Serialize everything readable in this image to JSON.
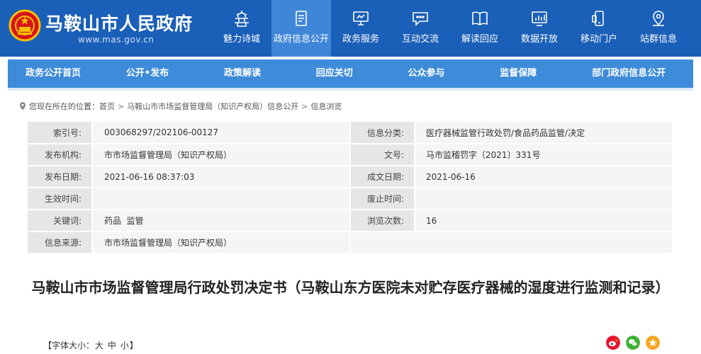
{
  "header": {
    "site_title": "马鞍山市人民政府",
    "site_url": "www.mas.gov.cn",
    "brand_color": "#1a5fb8",
    "active_color": "#3f86d8",
    "nav": [
      {
        "label": "魅力诗城",
        "icon": "pagoda-icon"
      },
      {
        "label": "政府信息公开",
        "icon": "document-icon",
        "active": true
      },
      {
        "label": "政务服务",
        "icon": "monitor-icon"
      },
      {
        "label": "互动交流",
        "icon": "chat-icon"
      },
      {
        "label": "解读回应",
        "icon": "open-book-icon"
      },
      {
        "label": "数据开放",
        "icon": "bar-chart-icon"
      },
      {
        "label": "移动门户",
        "icon": "mobile-icon"
      },
      {
        "label": "站群信息",
        "icon": "location-pin-icon"
      }
    ]
  },
  "secnav": {
    "items": [
      "政务公开首页",
      "公开•发布",
      "政策解读",
      "回应关切",
      "公众参与",
      "监督保障",
      "部门政府信息公开"
    ]
  },
  "breadcrumb": {
    "prefix": "您现在所在的位置：",
    "items": [
      "首页",
      "马鞍山市市场监督管理局（知识产权局）信息公开",
      "信息浏览"
    ],
    "sep": ">"
  },
  "meta": {
    "rows": [
      {
        "l1": "索引号:",
        "v1": "003068297/202106-00127",
        "l2": "信息分类:",
        "v2": "医疗器械监管行政处罚/食品药品监管/决定"
      },
      {
        "l1": "发布机构:",
        "v1": "市市场监督管理局（知识产权局）",
        "l2": "文号:",
        "v2": "马市监稽罚字〔2021〕331号"
      },
      {
        "l1": "发布日期:",
        "v1": "2021-06-16 08:37:03",
        "l2": "成文日期:",
        "v2": "2021-06-16"
      },
      {
        "l1": "生效时间:",
        "v1": "",
        "l2": "废止时间:",
        "v2": ""
      },
      {
        "l1": "关键词:",
        "v1": "药品  监管",
        "l2": "浏览次数:",
        "v2": "16"
      },
      {
        "l1": "信息来源:",
        "v1": "市市场监督管理局（知识产权局）",
        "l2": "",
        "v2": ""
      }
    ]
  },
  "doc": {
    "title": "马鞍山市市场监督管理局行政处罚决定书（马鞍山东方医院未对贮存医疗器械的湿度进行监测和记录）"
  },
  "fontsize": {
    "prefix": "【字体大小：",
    "large": "大",
    "medium": "中",
    "small": "小",
    "suffix": "】"
  },
  "share": {
    "items": [
      {
        "icon": "weibo-icon",
        "color": "#e6162d"
      },
      {
        "icon": "wechat-icon",
        "color": "#3eb135"
      },
      {
        "icon": "favorite-star-icon",
        "color": "#f5a623"
      }
    ]
  }
}
